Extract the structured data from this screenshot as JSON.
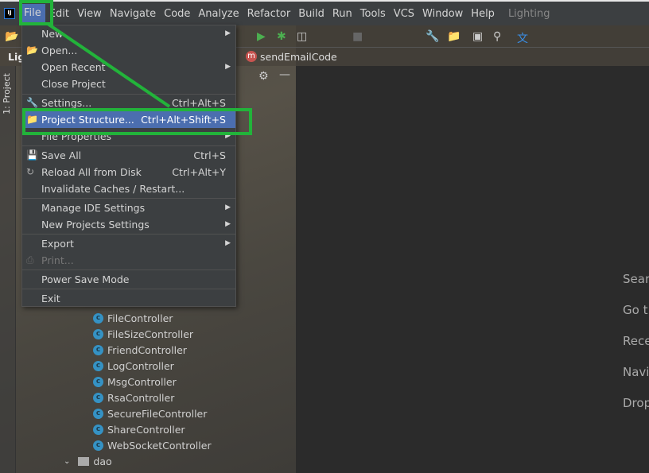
{
  "menubar": {
    "items": [
      "File",
      "Edit",
      "View",
      "Navigate",
      "Code",
      "Analyze",
      "Refactor",
      "Build",
      "Run",
      "Tools",
      "VCS",
      "Window",
      "Help"
    ],
    "project": "Lighting",
    "logo": "IJ"
  },
  "breadcrumb": {
    "left": "Lig",
    "method": "sendEmailCode",
    "method_icon": "m"
  },
  "sidebar": {
    "tab": "1: Project"
  },
  "file_menu": {
    "items": [
      {
        "label": "New",
        "submenu": true
      },
      {
        "label": "Open...",
        "icon": "folder-open"
      },
      {
        "label": "Open Recent",
        "submenu": true
      },
      {
        "label": "Close Project"
      },
      {
        "label": "Settings...",
        "shortcut": "Ctrl+Alt+S",
        "icon": "wrench"
      },
      {
        "label": "Project Structure...",
        "shortcut": "Ctrl+Alt+Shift+S",
        "icon": "project-structure",
        "selected": true
      },
      {
        "label": "File Properties",
        "submenu": true
      },
      {
        "label": "Save All",
        "shortcut": "Ctrl+S",
        "icon": "save"
      },
      {
        "label": "Reload All from Disk",
        "shortcut": "Ctrl+Alt+Y",
        "icon": "reload"
      },
      {
        "label": "Invalidate Caches / Restart..."
      },
      {
        "label": "Manage IDE Settings",
        "submenu": true
      },
      {
        "label": "New Projects Settings",
        "submenu": true
      },
      {
        "label": "Export",
        "submenu": true
      },
      {
        "label": "Print...",
        "icon": "print",
        "disabled": true
      },
      {
        "label": "Power Save Mode"
      },
      {
        "label": "Exit"
      }
    ]
  },
  "tree": {
    "items": [
      "FileController",
      "FileSizeController",
      "FriendController",
      "LogController",
      "MsgController",
      "RsaController",
      "SecureFileController",
      "ShareController",
      "WebSocketController"
    ],
    "folder": "dao"
  },
  "editor": {
    "hints": [
      "Sear",
      "Go t",
      "Rece",
      "Navi",
      "Drop"
    ]
  },
  "colors": {
    "highlight": "#22b33a",
    "selection": "#4b6eaf",
    "menu_bg": "#3c3f41"
  }
}
